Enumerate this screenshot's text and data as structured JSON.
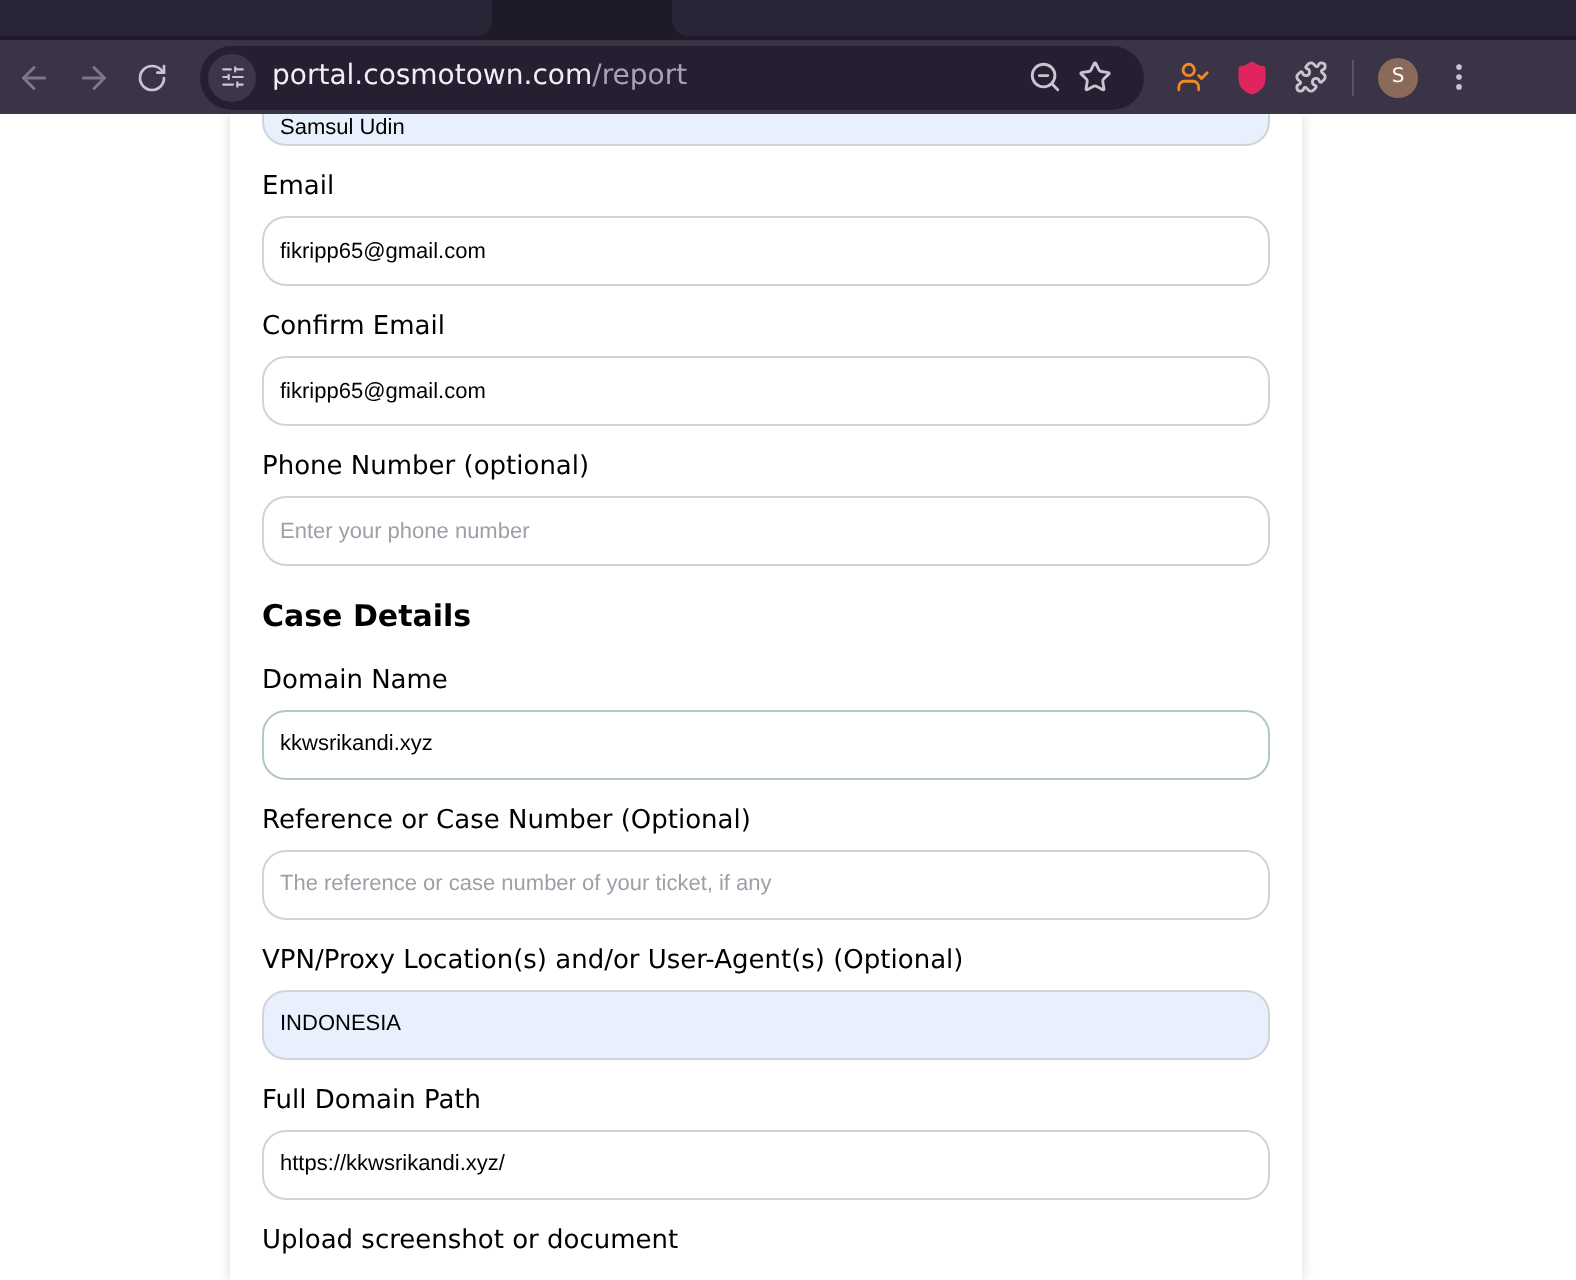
{
  "browser": {
    "url_host": "portal.cosmotown.com",
    "url_path": "/report",
    "avatar_letter": "S"
  },
  "top_field": {
    "value": "Samsul Udin",
    "autofilled": true
  },
  "fields": [
    {
      "kind": "field",
      "label": "Email",
      "value": "fikripp65@gmail.com",
      "autofilled": false,
      "focused": false
    },
    {
      "kind": "field",
      "label": "Confirm Email",
      "value": "fikripp65@gmail.com",
      "autofilled": false,
      "focused": false
    },
    {
      "kind": "field",
      "label": "Phone Number (optional)",
      "placeholder": "Enter your phone number",
      "autofilled": false,
      "focused": false
    },
    {
      "kind": "heading",
      "label": "Case Details"
    },
    {
      "kind": "field",
      "label": "Domain Name",
      "value": "kkwsrikandi.xyz",
      "autofilled": false,
      "focused": true
    },
    {
      "kind": "field",
      "label": "Reference or Case Number (Optional)",
      "placeholder": "The reference or case number of your ticket, if any",
      "autofilled": false,
      "focused": false
    },
    {
      "kind": "field",
      "label": "VPN/Proxy Location(s) and/or User-Agent(s) (Optional)",
      "value": "INDONESIA",
      "autofilled": true,
      "focused": false
    },
    {
      "kind": "field",
      "label": "Full Domain Path",
      "value": "https://kkwsrikandi.xyz/",
      "autofilled": false,
      "focused": false
    },
    {
      "kind": "label",
      "label": "Upload screenshot or document"
    }
  ]
}
